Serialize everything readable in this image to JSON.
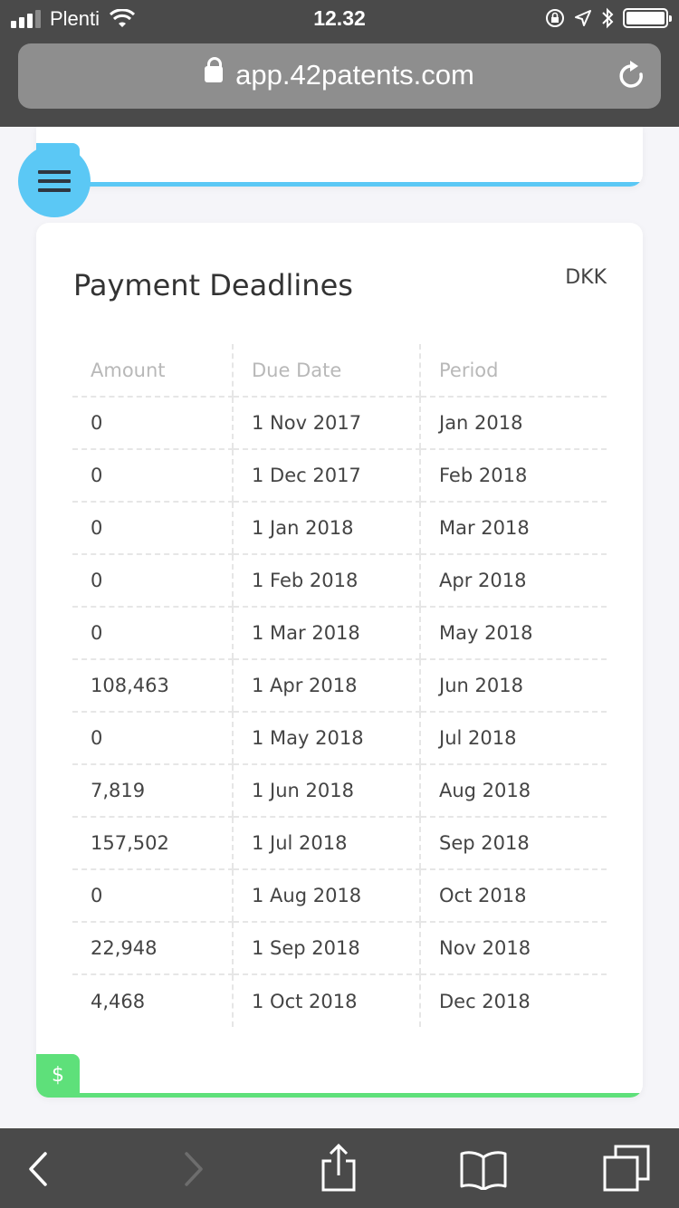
{
  "status_bar": {
    "carrier": "Plenti",
    "time": "12.32"
  },
  "browser": {
    "url": "app.42patents.com"
  },
  "card": {
    "title": "Payment Deadlines",
    "currency": "DKK",
    "columns": [
      "Amount",
      "Due Date",
      "Period"
    ],
    "rows": [
      [
        "0",
        "1 Nov 2017",
        "Jan 2018"
      ],
      [
        "0",
        "1 Dec 2017",
        "Feb 2018"
      ],
      [
        "0",
        "1 Jan 2018",
        "Mar 2018"
      ],
      [
        "0",
        "1 Feb 2018",
        "Apr 2018"
      ],
      [
        "0",
        "1 Mar 2018",
        "May 2018"
      ],
      [
        "108,463",
        "1 Apr 2018",
        "Jun 2018"
      ],
      [
        "0",
        "1 May 2018",
        "Jul 2018"
      ],
      [
        "7,819",
        "1 Jun 2018",
        "Aug 2018"
      ],
      [
        "157,502",
        "1 Jul 2018",
        "Sep 2018"
      ],
      [
        "0",
        "1 Aug 2018",
        "Oct 2018"
      ],
      [
        "22,948",
        "1 Sep 2018",
        "Nov 2018"
      ],
      [
        "4,468",
        "1 Oct 2018",
        "Dec 2018"
      ]
    ],
    "badge_symbol": "$"
  },
  "icons": [
    "menu-icon",
    "lock-icon",
    "reload-icon",
    "back-icon",
    "forward-icon",
    "share-icon",
    "bookmarks-icon",
    "tabs-icon"
  ],
  "colors": {
    "accent_blue": "#5bc8f5",
    "accent_green": "#5ee07a",
    "chrome": "#4a4a4a"
  }
}
